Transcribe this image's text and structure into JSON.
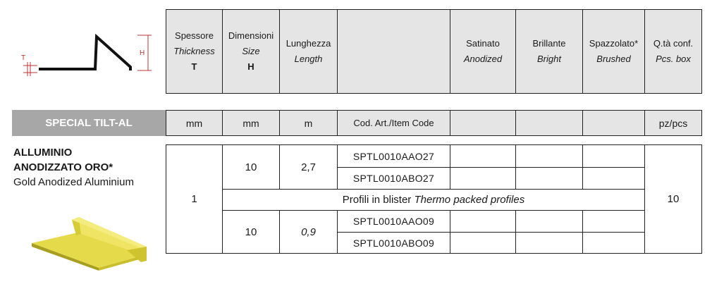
{
  "header": {
    "thickness": {
      "it": "Spessore",
      "en": "Thickness",
      "sym": "T"
    },
    "size": {
      "it": "Dimensioni",
      "en": "Size",
      "sym": "H"
    },
    "length": {
      "it": "Lunghezza",
      "en": "Length"
    },
    "anodized": {
      "it": "Satinato",
      "en": "Anodized"
    },
    "bright": {
      "it": "Brillante",
      "en": "Bright"
    },
    "brushed": {
      "it": "Spazzolato*",
      "en": "Brushed"
    },
    "qty": {
      "it": "Q.tà conf.",
      "en": "Pcs. box"
    }
  },
  "drawing": {
    "label_t": "T",
    "label_h": "H"
  },
  "product_bar": {
    "name": "SPECIAL TILT-AL",
    "unit_t": "mm",
    "unit_h": "mm",
    "unit_l": "m",
    "code_header": "Cod. Art./Item Code",
    "unit_q": "pz/pcs"
  },
  "product": {
    "line1": "ALLUMINIO",
    "line2": "ANODIZZATO ORO*",
    "line3": "Gold Anodized Aluminium"
  },
  "rows": {
    "thickness": "1",
    "qty": "10",
    "group1": {
      "size": "10",
      "length": "2,7",
      "codes": [
        "SPTL0010AAO27",
        "SPTL0010ABO27"
      ]
    },
    "blister": {
      "it": "Profili in blister",
      "en": "Thermo packed profiles"
    },
    "group2": {
      "size": "10",
      "length": "0,9",
      "codes": [
        "SPTL0010AAO09",
        "SPTL0010ABO09"
      ]
    }
  },
  "colors": {
    "header_bg": "#e5e5e5",
    "bar_bg": "#a7a7a7",
    "profile_gold": "#dcd23a"
  }
}
